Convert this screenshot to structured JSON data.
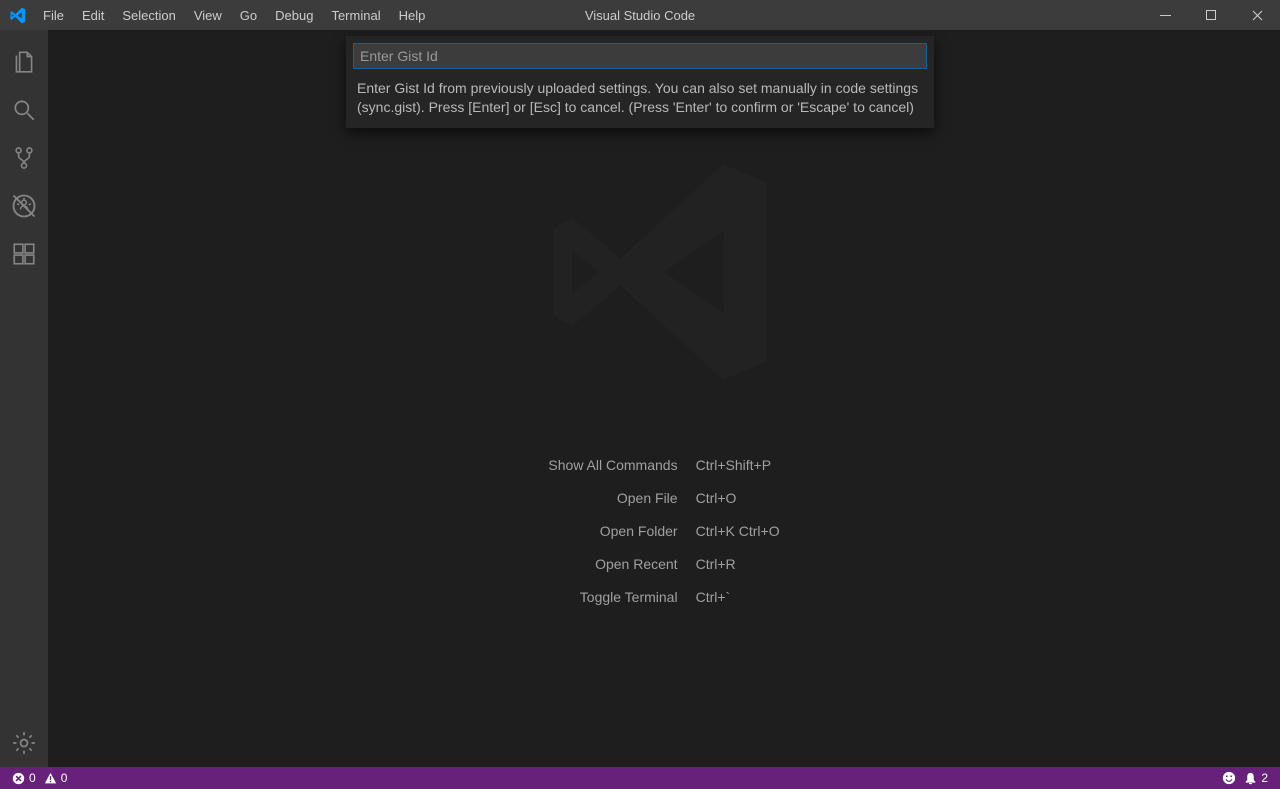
{
  "title": "Visual Studio Code",
  "menu": [
    "File",
    "Edit",
    "Selection",
    "View",
    "Go",
    "Debug",
    "Terminal",
    "Help"
  ],
  "quickinput": {
    "placeholder": "Enter Gist Id",
    "hint": "Enter Gist Id from previously uploaded settings. You can also set manually in code settings (sync.gist). Press [Enter] or [Esc] to cancel. (Press 'Enter' to confirm or 'Escape' to cancel)"
  },
  "shortcuts": [
    {
      "label": "Show All Commands",
      "key": "Ctrl+Shift+P"
    },
    {
      "label": "Open File",
      "key": "Ctrl+O"
    },
    {
      "label": "Open Folder",
      "key": "Ctrl+K Ctrl+O"
    },
    {
      "label": "Open Recent",
      "key": "Ctrl+R"
    },
    {
      "label": "Toggle Terminal",
      "key": "Ctrl+`"
    }
  ],
  "status": {
    "errors": "0",
    "warnings": "0",
    "notifications": "2"
  },
  "colors": {
    "statusbar": "#68217a"
  }
}
